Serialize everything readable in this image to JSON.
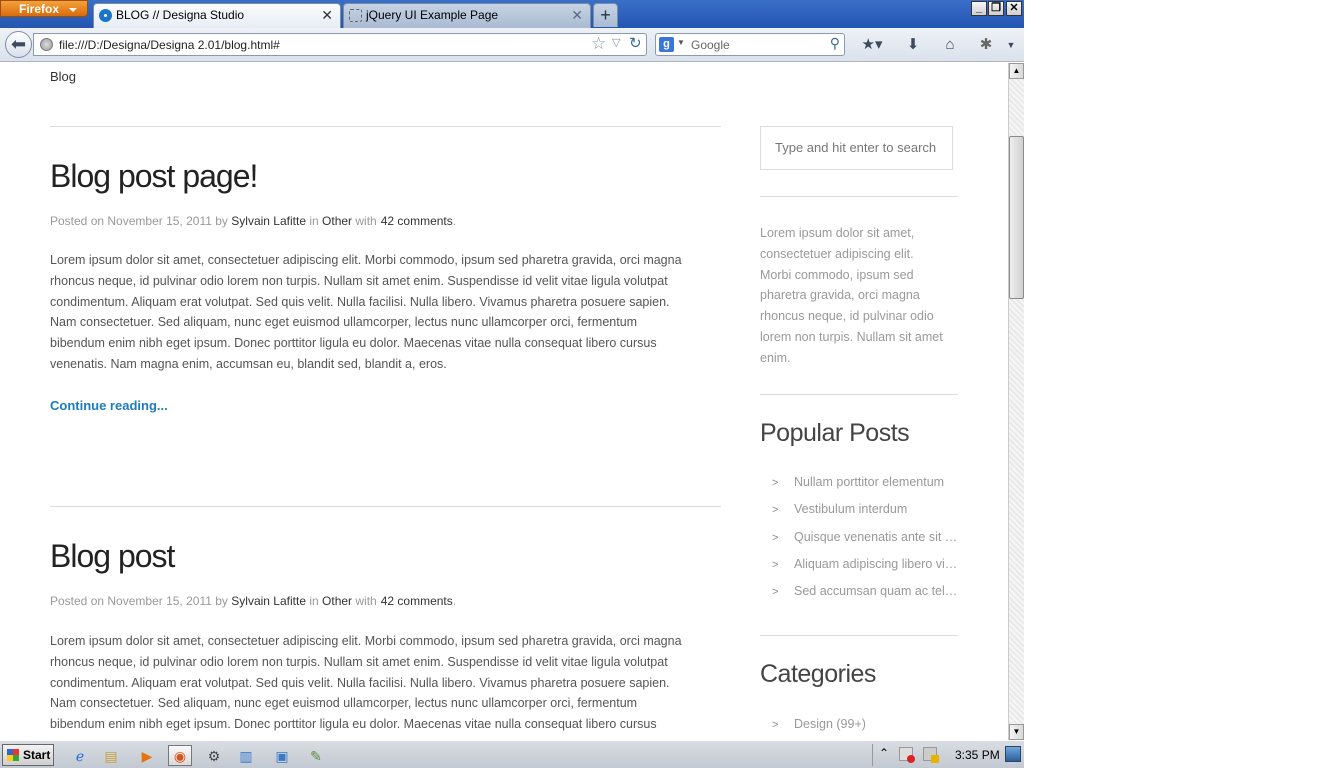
{
  "browser": {
    "app_button": "Firefox",
    "tabs": [
      {
        "title": "BLOG // Designa Studio",
        "active": true
      },
      {
        "title": "jQuery UI Example Page",
        "active": false
      }
    ],
    "new_tab": "+",
    "window_controls": {
      "minimize": "_",
      "maximize": "❐",
      "close": "✕"
    },
    "url": "file:///D:/Designa/Designa 2.01/blog.html#",
    "search": {
      "engine_icon": "g",
      "placeholder": "Google"
    },
    "icons": [
      "back-arrow-icon",
      "globe-icon",
      "star-icon",
      "reload-icon",
      "search-icon",
      "bookmarks-icon",
      "downloads-icon",
      "home-icon",
      "addon-icon",
      "menu-icon"
    ]
  },
  "page": {
    "breadcrumb": "Blog",
    "posts": [
      {
        "title": "Blog post page!",
        "meta": {
          "posted_on": "Posted on",
          "date": "November 15, 2011",
          "by": "by",
          "author": "Sylvain Lafitte",
          "in": "in",
          "category": "Other",
          "with": "with",
          "comments": "42 comments",
          "end": "."
        },
        "lines": [
          "Lorem ipsum dolor sit amet, consectetuer adipiscing elit. Morbi commodo, ipsum sed pharetra gravida, orci magna",
          "rhoncus neque, id pulvinar odio lorem non turpis. Nullam sit amet enim. Suspendisse id velit vitae ligula volutpat",
          "condimentum. Aliquam erat volutpat. Sed quis velit. Nulla facilisi. Nulla libero. Vivamus pharetra posuere sapien.",
          "Nam consectetuer. Sed aliquam, nunc eget euismod ullamcorper, lectus nunc ullamcorper orci, fermentum",
          "bibendum enim nibh eget ipsum. Donec porttitor ligula eu dolor. Maecenas vitae nulla consequat libero cursus",
          "venenatis. Nam magna enim, accumsan eu, blandit sed, blandit a, eros."
        ],
        "read_more": "Continue reading..."
      },
      {
        "title": "Blog post",
        "meta": {
          "posted_on": "Posted on",
          "date": "November 15, 2011",
          "by": "by",
          "author": "Sylvain Lafitte",
          "in": "in",
          "category": "Other",
          "with": "with",
          "comments": "42 comments",
          "end": "."
        },
        "lines": [
          "Lorem ipsum dolor sit amet, consectetuer adipiscing elit. Morbi commodo, ipsum sed pharetra gravida, orci magna",
          "rhoncus neque, id pulvinar odio lorem non turpis. Nullam sit amet enim. Suspendisse id velit vitae ligula volutpat",
          "condimentum. Aliquam erat volutpat. Sed quis velit. Nulla facilisi. Nulla libero. Vivamus pharetra posuere sapien.",
          "Nam consectetuer. Sed aliquam, nunc eget euismod ullamcorper, lectus nunc ullamcorper orci, fermentum",
          "bibendum enim nibh eget ipsum. Donec porttitor ligula eu dolor. Maecenas vitae nulla consequat libero cursus"
        ]
      }
    ],
    "sidebar": {
      "search_placeholder": "Type and hit enter to search",
      "text_lines": [
        "Lorem ipsum dolor sit amet,",
        "consectetuer adipiscing elit.",
        "Morbi commodo, ipsum sed",
        "pharetra gravida, orci magna",
        "rhoncus neque, id pulvinar odio",
        "lorem non turpis. Nullam sit amet",
        "enim."
      ],
      "popular_heading": "Popular Posts",
      "popular_posts": [
        "Nullam porttitor elementum",
        "Vestibulum interdum",
        "Quisque venenatis ante sit amet",
        "Aliquam adipiscing libero vitae",
        "Sed accumsan quam ac tellus"
      ],
      "categories_heading": "Categories",
      "categories": [
        "Design (99+)"
      ],
      "chevron": ">"
    }
  },
  "scrollbar": {
    "up": "▲",
    "down": "▼"
  },
  "taskbar": {
    "start": "Start",
    "clock": "3:35 PM",
    "tray_arrow": "⌃"
  },
  "colors": {
    "link_blue": "#1d7cbf",
    "title_dark": "#222222",
    "meta_gray": "#999999"
  }
}
